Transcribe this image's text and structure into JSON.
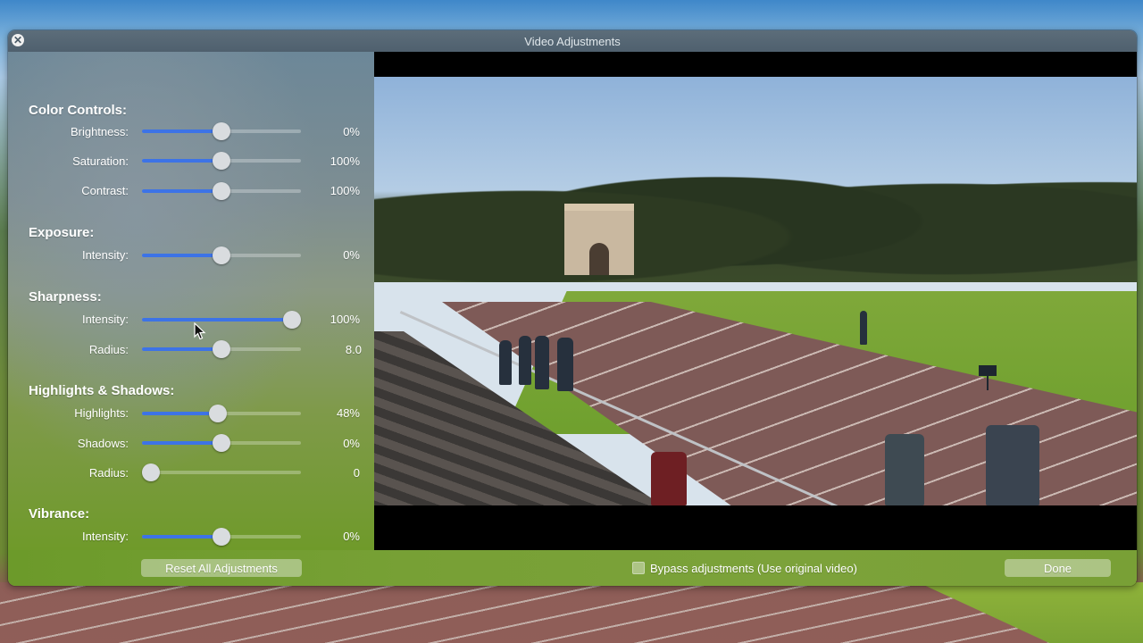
{
  "window": {
    "title": "Video Adjustments"
  },
  "sections": [
    {
      "title": "Color Controls:",
      "rows": [
        {
          "label": "Brightness:",
          "value": "0%",
          "level": 0.5
        },
        {
          "label": "Saturation:",
          "value": "100%",
          "level": 0.5
        },
        {
          "label": "Contrast:",
          "value": "100%",
          "level": 0.5
        }
      ]
    },
    {
      "title": "Exposure:",
      "rows": [
        {
          "label": "Intensity:",
          "value": "0%",
          "level": 0.5
        }
      ]
    },
    {
      "title": "Sharpness:",
      "rows": [
        {
          "label": "Intensity:",
          "value": "100%",
          "level": 1.0
        },
        {
          "label": "Radius:",
          "value": "8.0",
          "level": 0.5
        }
      ]
    },
    {
      "title": "Highlights & Shadows:",
      "rows": [
        {
          "label": "Highlights:",
          "value": "48%",
          "level": 0.48
        },
        {
          "label": "Shadows:",
          "value": "0%",
          "level": 0.5
        },
        {
          "label": "Radius:",
          "value": "0",
          "level": 0.0
        }
      ]
    },
    {
      "title": "Vibrance:",
      "rows": [
        {
          "label": "Intensity:",
          "value": "0%",
          "level": 0.5
        }
      ]
    }
  ],
  "footer": {
    "reset_label": "Reset All Adjustments",
    "bypass_label": "Bypass adjustments (Use original video)",
    "bypass_checked": false,
    "done_label": "Done"
  },
  "colors": {
    "accent": "#3d73e6",
    "preview_bg": "#000000"
  },
  "icons": {
    "close": "close-icon",
    "cursor": "pointer-cursor-icon"
  }
}
